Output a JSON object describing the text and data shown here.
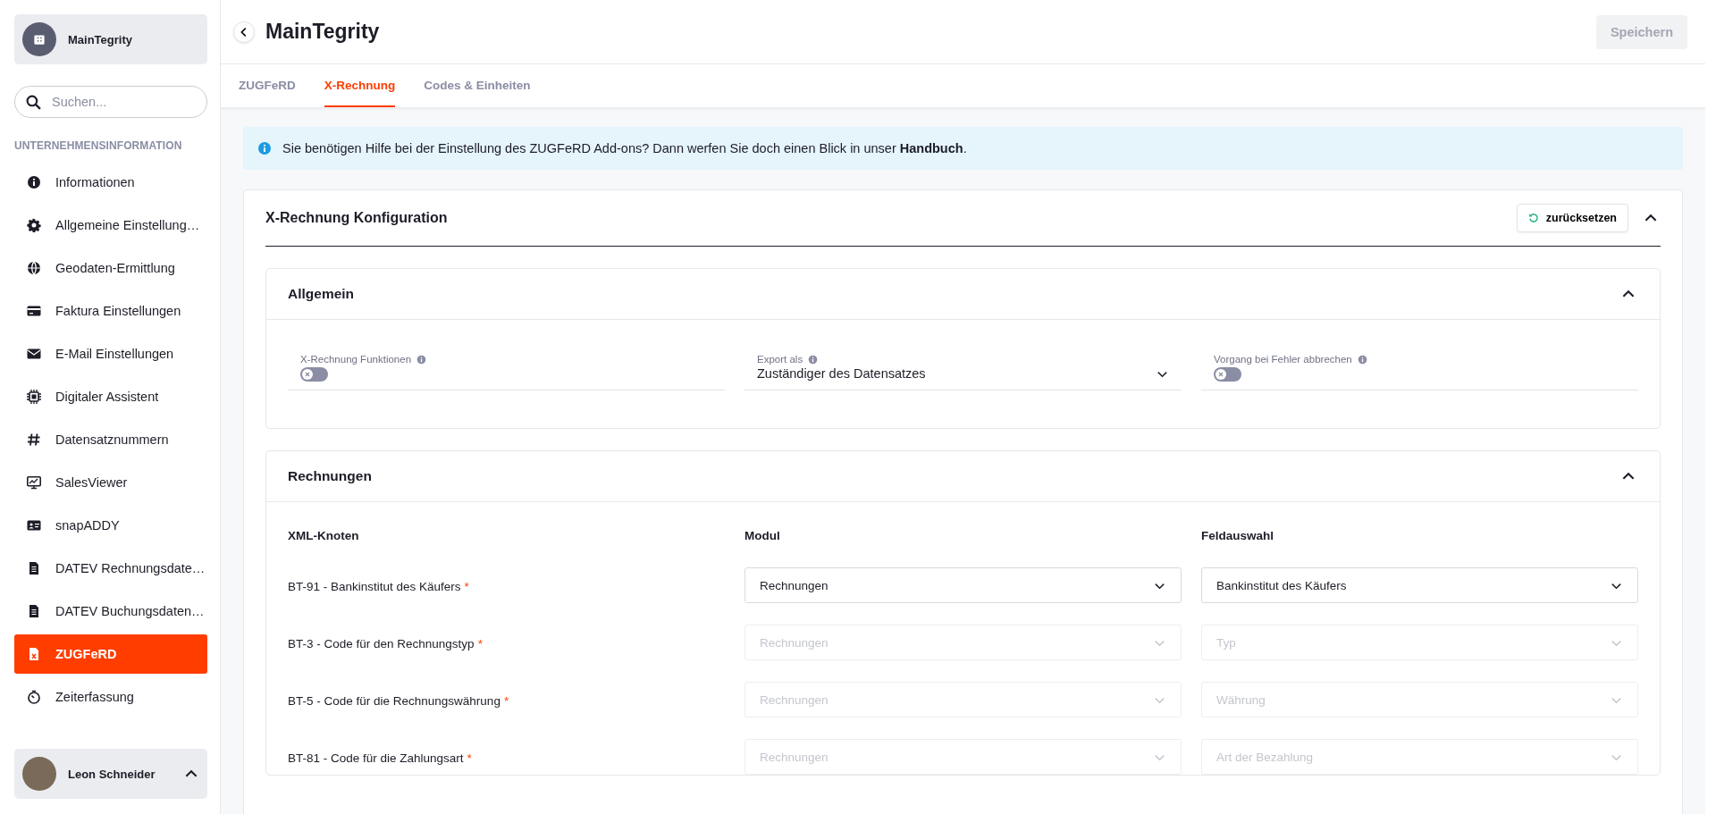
{
  "sidebar": {
    "org": {
      "name": "MainTegrity"
    },
    "search": {
      "placeholder": "Suchen..."
    },
    "section_title": "UNTERNEHMENSINFORMATION",
    "items": [
      {
        "label": "Informationen",
        "kind": "info",
        "selected": false
      },
      {
        "label": "Allgemeine Einstellung…",
        "kind": "gear",
        "selected": false
      },
      {
        "label": "Geodaten-Ermittlung",
        "kind": "globe",
        "selected": false
      },
      {
        "label": "Faktura Einstellungen",
        "kind": "card",
        "selected": false
      },
      {
        "label": "E-Mail Einstellungen",
        "kind": "mail",
        "selected": false
      },
      {
        "label": "Digitaler Assistent",
        "kind": "chip",
        "selected": false
      },
      {
        "label": "Datensatznummern",
        "kind": "hash",
        "selected": false
      },
      {
        "label": "SalesViewer",
        "kind": "monitor",
        "selected": false
      },
      {
        "label": "snapADDY",
        "kind": "idcard",
        "selected": false
      },
      {
        "label": "DATEV Rechnungsdate…",
        "kind": "doc",
        "selected": false
      },
      {
        "label": "DATEV Buchungsdaten…",
        "kind": "doc",
        "selected": false
      },
      {
        "label": "ZUGFeRD",
        "kind": "xdoc",
        "selected": true
      },
      {
        "label": "Zeiterfassung",
        "kind": "timer",
        "selected": false
      }
    ],
    "user": {
      "name": "Leon Schneider",
      "expanded": true
    }
  },
  "header": {
    "title": "MainTegrity",
    "save_button": {
      "label": "Speichern",
      "disabled": true
    }
  },
  "tabs": [
    {
      "label": "ZUGFeRD",
      "selected": false
    },
    {
      "label": "X-Rechnung",
      "selected": true
    },
    {
      "label": "Codes & Einheiten",
      "selected": false
    }
  ],
  "info_banner": {
    "text": "Sie benötigen Hilfe bei der Einstellung des ZUGFeRD Add-ons? Dann werfen Sie doch einen Blick in unser ",
    "link": "Handbuch",
    "suffix": "."
  },
  "config": {
    "title": "X-Rechnung Konfiguration",
    "reset_button": "zurücksetzen",
    "expanded": true,
    "general": {
      "title": "Allgemein",
      "expanded": true,
      "fields": [
        {
          "kind": "toggle",
          "label": "X-Rechnung Funktionen",
          "on": false
        },
        {
          "kind": "select",
          "label": "Export als",
          "value": "Zuständiger des Datensatzes"
        },
        {
          "kind": "toggle",
          "label": "Vorgang bei Fehler abbrechen",
          "on": false
        }
      ]
    },
    "invoices": {
      "title": "Rechnungen",
      "expanded": true,
      "columns": [
        "XML-Knoten",
        "Modul",
        "Feldauswahl"
      ],
      "rows": [
        {
          "node": "BT-91 - Bankinstitut des Käufers",
          "required_mark": "*",
          "module": "Rechnungen",
          "field": "Bankinstitut des Käufers",
          "disabled": false
        },
        {
          "node": "BT-3 - Code für den Rechnungstyp",
          "required_mark": "*",
          "module": "Rechnungen",
          "field": "Typ",
          "disabled": true
        },
        {
          "node": "BT-5 - Code für die Rechnungswährung",
          "required_mark": "*",
          "module": "Rechnungen",
          "field": "Währung",
          "disabled": true
        },
        {
          "node": "BT-81 - Code für die Zahlungsart",
          "required_mark": "*",
          "module": "Rechnungen",
          "field": "Art der Bezahlung",
          "disabled": true
        }
      ]
    }
  }
}
